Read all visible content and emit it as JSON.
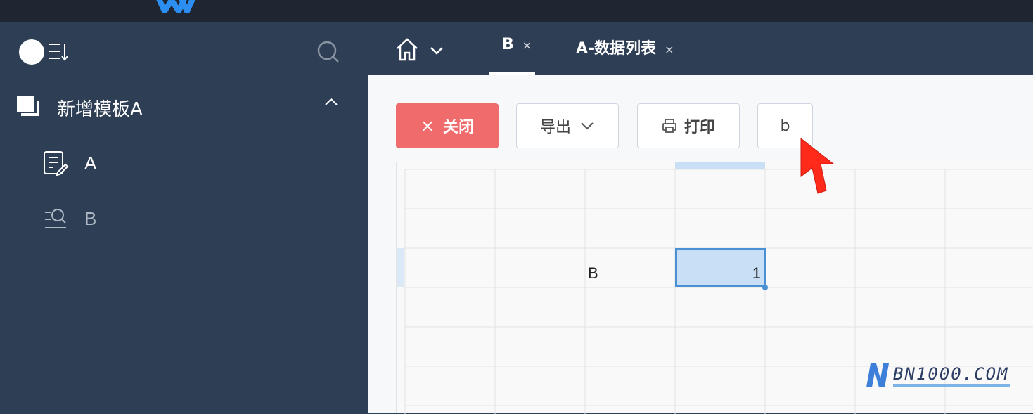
{
  "sidebar": {
    "group_label": "新增模板A",
    "items": [
      {
        "label": "A",
        "icon": "edit-document-icon"
      },
      {
        "label": "B",
        "icon": "search-list-icon"
      }
    ]
  },
  "tabs": [
    {
      "label": "B",
      "close": "×",
      "active": true
    },
    {
      "label": "A-数据列表",
      "close": "×",
      "active": false
    }
  ],
  "toolbar": {
    "close_label": "关闭",
    "close_icon": "×",
    "export_label": "导出",
    "print_label": "打印",
    "b_label": "b"
  },
  "sheet": {
    "cell_b_text": "B",
    "cell_value": "1"
  },
  "watermark": {
    "text": "BN1000.COM"
  },
  "colors": {
    "sidebar_bg": "#2e3e54",
    "topbar_bg": "#1f2632",
    "close_button": "#f06b6b",
    "selection": "#4a90d2",
    "cursor": "#ff2a1a"
  }
}
